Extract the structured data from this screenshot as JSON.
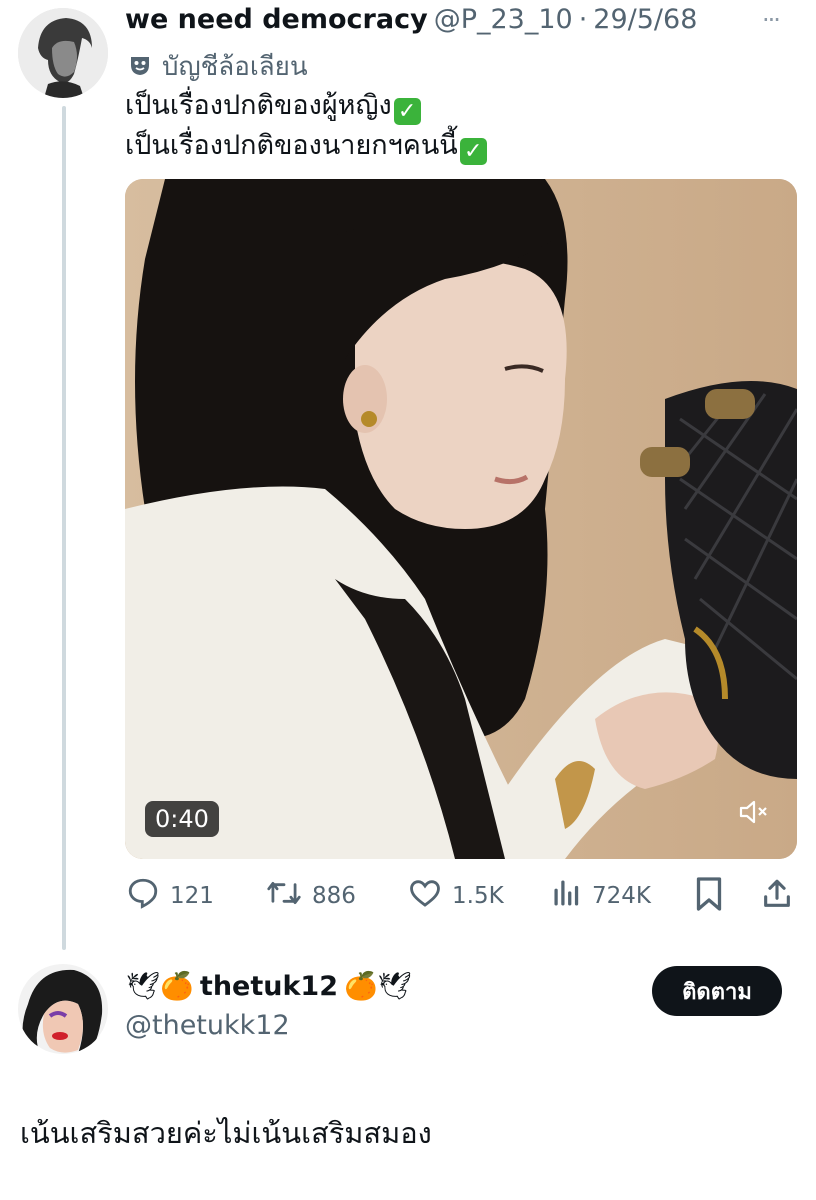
{
  "tweet": {
    "author_name": "we need democracy",
    "handle": "@P_23_10",
    "separator": "·",
    "date": "29/5/68",
    "more_label": "···",
    "label_text": "บัญชีล้อเลียน",
    "text_lines": [
      "เป็นเรื่องปกติของผู้หญิง",
      "เป็นเรื่องปกติของนายกฯคนนี้"
    ],
    "check_glyph": "✓",
    "video_duration": "0:40",
    "actions": {
      "replies": "121",
      "retweets": "886",
      "likes": "1.5K",
      "views": "724K"
    }
  },
  "reply": {
    "author_emoji_prefix": "🕊🍊",
    "author_name": "thetuk12",
    "author_emoji_suffix": "🍊🕊",
    "handle": "@thetukk12",
    "follow_label": "ติดตาม",
    "text": "เน้นเสริมสวยค่ะไม่เน้นเสริมสมอง"
  },
  "colors": {
    "text": "#0f1419",
    "secondary": "#536471",
    "thread_line": "#cfd9de",
    "follow_button": "#0f1419",
    "check": "#3bb33b"
  }
}
